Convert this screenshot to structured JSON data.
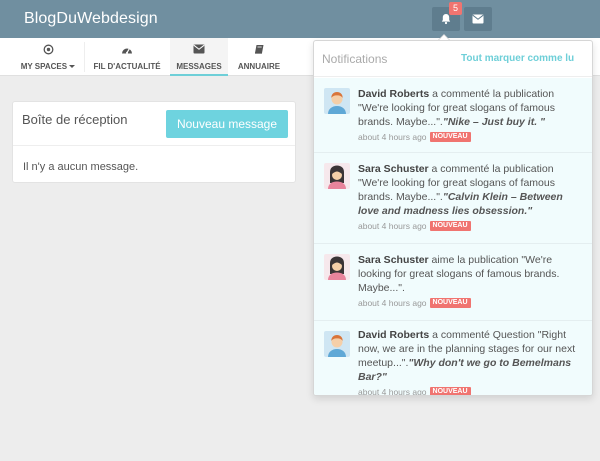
{
  "header": {
    "brand": "BlogDuWebdesign",
    "notification_count": "5",
    "icons": [
      "bell-icon",
      "envelope-icon"
    ]
  },
  "nav": {
    "items": [
      {
        "label": "My Spaces",
        "icon": "circle-dot-icon",
        "dropdown": true
      },
      {
        "label": "Fil d'actualité",
        "icon": "dashboard-icon"
      },
      {
        "label": "Messages",
        "icon": "envelope-icon",
        "active": true
      },
      {
        "label": "Annuaire",
        "icon": "book-icon"
      }
    ]
  },
  "inbox": {
    "title": "Boîte de réception",
    "new_button": "Nouveau message",
    "empty_text": "Il n'y a aucun message."
  },
  "notifications": {
    "title": "Notifications",
    "mark_all": "Tout marquer comme lu",
    "items": [
      {
        "author": "David Roberts",
        "action": " a commenté la publication \"We're looking for great slogans of famous brands. Maybe...\".",
        "quote": "\"Nike – Just buy it. \"",
        "time": "about 4 hours ago",
        "badge": "NOUVEAU",
        "avatar": "male-avatar"
      },
      {
        "author": "Sara Schuster",
        "action": " a commenté la publication \"We're looking for great slogans of famous brands. Maybe...\".",
        "quote": "\"Calvin Klein – Between love and madness lies obsession.\"",
        "time": "about 4 hours ago",
        "badge": "NOUVEAU",
        "avatar": "female-avatar"
      },
      {
        "author": "Sara Schuster",
        "action": " aime la publication \"We're looking for great slogans of famous brands. Maybe...\".",
        "quote": "",
        "time": "about 4 hours ago",
        "badge": "NOUVEAU",
        "avatar": "female-avatar"
      },
      {
        "author": "David Roberts",
        "action": " a commenté Question \"Right now, we are in the planning stages for our next meetup...\".",
        "quote": "\"Why don't we go to Bemelmans Bar?\"",
        "time": "about 4 hours ago",
        "badge": "NOUVEAU",
        "avatar": "male-avatar"
      }
    ]
  },
  "colors": {
    "topbar": "#708fa0",
    "accent": "#6ed3df",
    "badge": "#f07470"
  }
}
